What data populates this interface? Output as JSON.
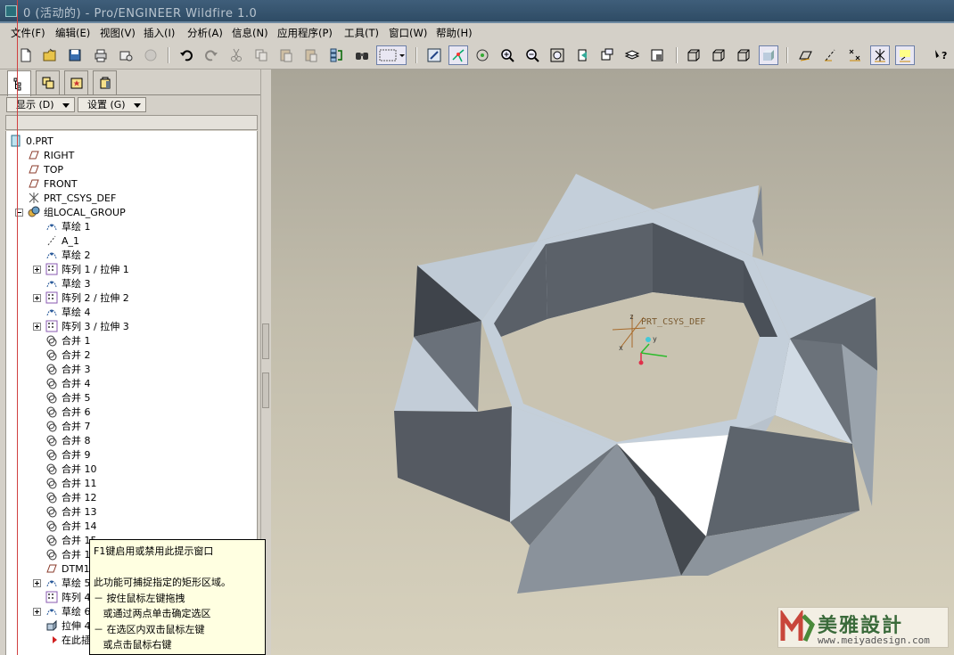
{
  "window": {
    "title": "0 (活动的) - Pro/ENGINEER Wildfire 1.0"
  },
  "menu": {
    "items": [
      {
        "label": "文件(F)"
      },
      {
        "label": "编辑(E)"
      },
      {
        "label": "视图(V)"
      },
      {
        "label": "插入(I)"
      },
      {
        "label": "分析(A)"
      },
      {
        "label": "信息(N)"
      },
      {
        "label": "应用程序(P)"
      },
      {
        "label": "工具(T)"
      },
      {
        "label": "窗口(W)"
      },
      {
        "label": "帮助(H)"
      }
    ]
  },
  "toolbar": {
    "icons": [
      "new-file-icon",
      "open-folder-icon",
      "save-icon",
      "print-icon",
      "email-icon",
      "send-icon",
      "undo-icon",
      "redo-icon",
      "cut-icon",
      "copy-icon",
      "paste-icon",
      "paste-special-icon",
      "regenerate-icon",
      "find-icon",
      "select-box-icon",
      "repaint-icon",
      "spin-center-icon",
      "orient-mode-icon",
      "zoom-in-icon",
      "zoom-out-icon",
      "refit-icon",
      "reorient-icon",
      "saved-views-icon",
      "layers-icon",
      "view-manager-icon",
      "wireframe-icon",
      "hidden-line-icon",
      "no-hidden-icon",
      "shading-icon",
      "datum-planes-icon",
      "datum-axes-icon",
      "datum-points-icon",
      "coord-sys-icon",
      "annotations-icon",
      "context-help-icon"
    ]
  },
  "navigator": {
    "tabs": [
      "model-tree-tab",
      "folder-browser-tab",
      "favorites-tab",
      "connections-tab"
    ],
    "show_label": "显示 (D)",
    "settings_label": "设置 (G)"
  },
  "tree": {
    "root": "0.PRT",
    "items": [
      {
        "label": "RIGHT",
        "icon": "datum-plane-icon"
      },
      {
        "label": "TOP",
        "icon": "datum-plane-icon"
      },
      {
        "label": "FRONT",
        "icon": "datum-plane-icon"
      },
      {
        "label": "PRT_CSYS_DEF",
        "icon": "coord-sys-icon"
      },
      {
        "label": "组LOCAL_GROUP",
        "icon": "group-icon"
      },
      {
        "label": "草绘 1",
        "icon": "sketch-icon"
      },
      {
        "label": "A_1",
        "icon": "axis-icon"
      },
      {
        "label": "草绘 2",
        "icon": "sketch-icon"
      },
      {
        "label": "阵列 1 / 拉伸 1",
        "icon": "pattern-icon"
      },
      {
        "label": "草绘 3",
        "icon": "sketch-icon"
      },
      {
        "label": "阵列 2 / 拉伸 2",
        "icon": "pattern-icon"
      },
      {
        "label": "草绘 4",
        "icon": "sketch-icon"
      },
      {
        "label": "阵列 3 / 拉伸 3",
        "icon": "pattern-icon"
      },
      {
        "label": "合并 1",
        "icon": "merge-icon"
      },
      {
        "label": "合并 2",
        "icon": "merge-icon"
      },
      {
        "label": "合并 3",
        "icon": "merge-icon"
      },
      {
        "label": "合并 4",
        "icon": "merge-icon"
      },
      {
        "label": "合并 5",
        "icon": "merge-icon"
      },
      {
        "label": "合并 6",
        "icon": "merge-icon"
      },
      {
        "label": "合并 7",
        "icon": "merge-icon"
      },
      {
        "label": "合并 8",
        "icon": "merge-icon"
      },
      {
        "label": "合并 9",
        "icon": "merge-icon"
      },
      {
        "label": "合并 10",
        "icon": "merge-icon"
      },
      {
        "label": "合并 11",
        "icon": "merge-icon"
      },
      {
        "label": "合并 12",
        "icon": "merge-icon"
      },
      {
        "label": "合并 13",
        "icon": "merge-icon"
      },
      {
        "label": "合并 14",
        "icon": "merge-icon"
      },
      {
        "label": "合并 15",
        "icon": "merge-icon"
      },
      {
        "label": "合并 1",
        "icon": "merge-icon"
      },
      {
        "label": "DTM1",
        "icon": "datum-plane-icon"
      },
      {
        "label": "草绘 5",
        "icon": "sketch-icon"
      },
      {
        "label": "阵列 4",
        "icon": "pattern-icon"
      },
      {
        "label": "草绘 6",
        "icon": "sketch-icon"
      },
      {
        "label": "拉伸 4",
        "icon": "extrude-icon"
      },
      {
        "label": "在此插入",
        "icon": "insert-here-icon"
      }
    ]
  },
  "tooltip": {
    "lines": [
      "F1键启用或禁用此提示窗口",
      "",
      "此功能可捕捉指定的矩形区域。",
      "－ 按住鼠标左键拖拽",
      "   或通过两点单击确定选区",
      "－ 在选区内双击鼠标左键",
      "   或点击鼠标右键"
    ]
  },
  "viewport": {
    "csys_label": "PRT_CSYS_DEF",
    "axis_labels": {
      "x": "x",
      "y": "y",
      "z": "z"
    }
  },
  "watermark": {
    "text": "美雅設計",
    "url": "www.meiyadesign.com"
  },
  "colors": {
    "titlebar": "#2d4a63",
    "menubar": "#d4d0c8",
    "viewport_top": "#a9a598",
    "viewport_bottom": "#d7d1bd",
    "tooltip_bg": "#ffffe1",
    "model_face_light": "#c2cdd8",
    "model_face_dark": "#555b63"
  }
}
